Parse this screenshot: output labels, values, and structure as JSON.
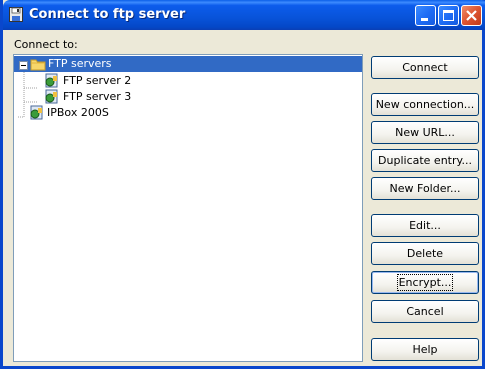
{
  "window": {
    "title": "Connect to ftp server"
  },
  "connect_label": "Connect to:",
  "tree": {
    "items": [
      {
        "label": "FTP servers",
        "icon": "folder-icon",
        "expanded": true,
        "selected": true
      },
      {
        "label": "FTP server 2",
        "icon": "ftp-server-icon"
      },
      {
        "label": "FTP server 3",
        "icon": "ftp-server-icon"
      },
      {
        "label": "IPBox 200S",
        "icon": "ftp-server-icon"
      }
    ]
  },
  "buttons": {
    "connect": "Connect",
    "new_connection": "New connection...",
    "new_url": "New URL...",
    "duplicate_entry": "Duplicate entry...",
    "new_folder": "New Folder...",
    "edit": "Edit...",
    "delete": "Delete",
    "encrypt": "Encrypt...",
    "cancel": "Cancel",
    "help": "Help"
  },
  "colors": {
    "selection": "#316ac5",
    "titlebar": "#0853d9",
    "dialog_bg": "#ece9d8"
  }
}
